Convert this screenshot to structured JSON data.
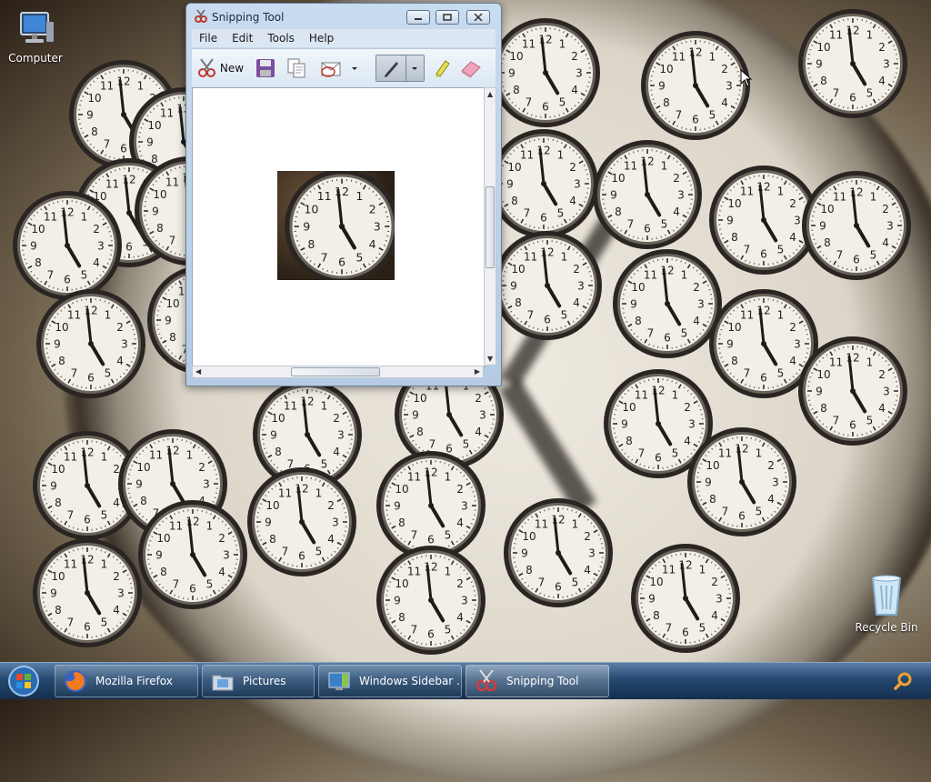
{
  "desktop": {
    "icons": [
      {
        "label": "Computer",
        "icon": "computer-icon"
      },
      {
        "label": "Recycle Bin",
        "icon": "recycle-bin-icon"
      }
    ],
    "gadget": "clock"
  },
  "window": {
    "title": "Snipping Tool",
    "menu": [
      "File",
      "Edit",
      "Tools",
      "Help"
    ],
    "toolbar": {
      "new_label": "New",
      "tools": [
        "new-snip-icon",
        "save-icon",
        "copy-icon",
        "send-snip-icon",
        "pen-icon",
        "highlighter-icon",
        "eraser-icon"
      ]
    },
    "controls": {
      "minimize": "minimize",
      "maximize": "maximize",
      "close": "close"
    }
  },
  "taskbar": {
    "start": "Start",
    "items": [
      {
        "label": "Mozilla Firefox",
        "icon": "firefox-icon",
        "active": false
      },
      {
        "label": "Pictures",
        "icon": "pictures-folder-icon",
        "active": false
      },
      {
        "label": "Windows Sidebar ...",
        "icon": "sidebar-icon",
        "active": false
      },
      {
        "label": "Snipping Tool",
        "icon": "snipping-tool-icon",
        "active": true
      }
    ]
  }
}
